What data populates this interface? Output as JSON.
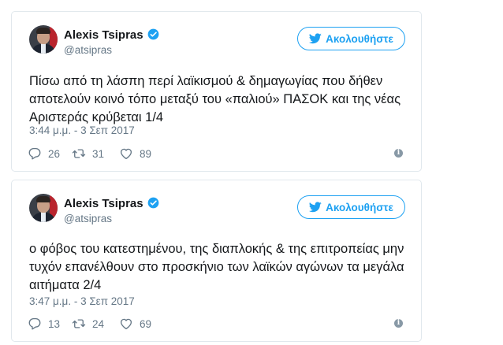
{
  "tweets": [
    {
      "author_name": "Alexis Tsipras",
      "author_handle": "@atsipras",
      "follow_label": "Ακολουθήστε",
      "text": "Πίσω από τη λάσπη περί λαϊκισμού & δημαγωγίας που δήθεν\nαποτελούν κοινό τόπο μεταξύ του «παλιού» ΠΑΣΟΚ και της νέας\nΑριστεράς κρύβεται 1/4",
      "timestamp": "3:44 μ.μ. - 3 Σεπ 2017",
      "replies": "26",
      "retweets": "31",
      "likes": "89"
    },
    {
      "author_name": "Alexis Tsipras",
      "author_handle": "@atsipras",
      "follow_label": "Ακολουθήστε",
      "text": "ο φόβος του κατεστημένου, της διαπλοκής & της επιτροπείας μην\nτυχόν επανέλθουν στο προσκήνιο των λαϊκών αγώνων τα μεγάλα\nαιτήματα 2/4",
      "timestamp": "3:47 μ.μ. - 3 Σεπ 2017",
      "replies": "13",
      "retweets": "24",
      "likes": "69"
    }
  ],
  "icons": {
    "verified": "verified-badge-icon",
    "follow": "twitter-bird-icon",
    "reply": "reply-icon",
    "retweet": "retweet-icon",
    "like": "heart-icon",
    "info": "info-icon"
  },
  "colors": {
    "accent": "#1da1f2",
    "muted_text": "#657786",
    "text": "#14171a",
    "border": "#e1e8ed"
  }
}
